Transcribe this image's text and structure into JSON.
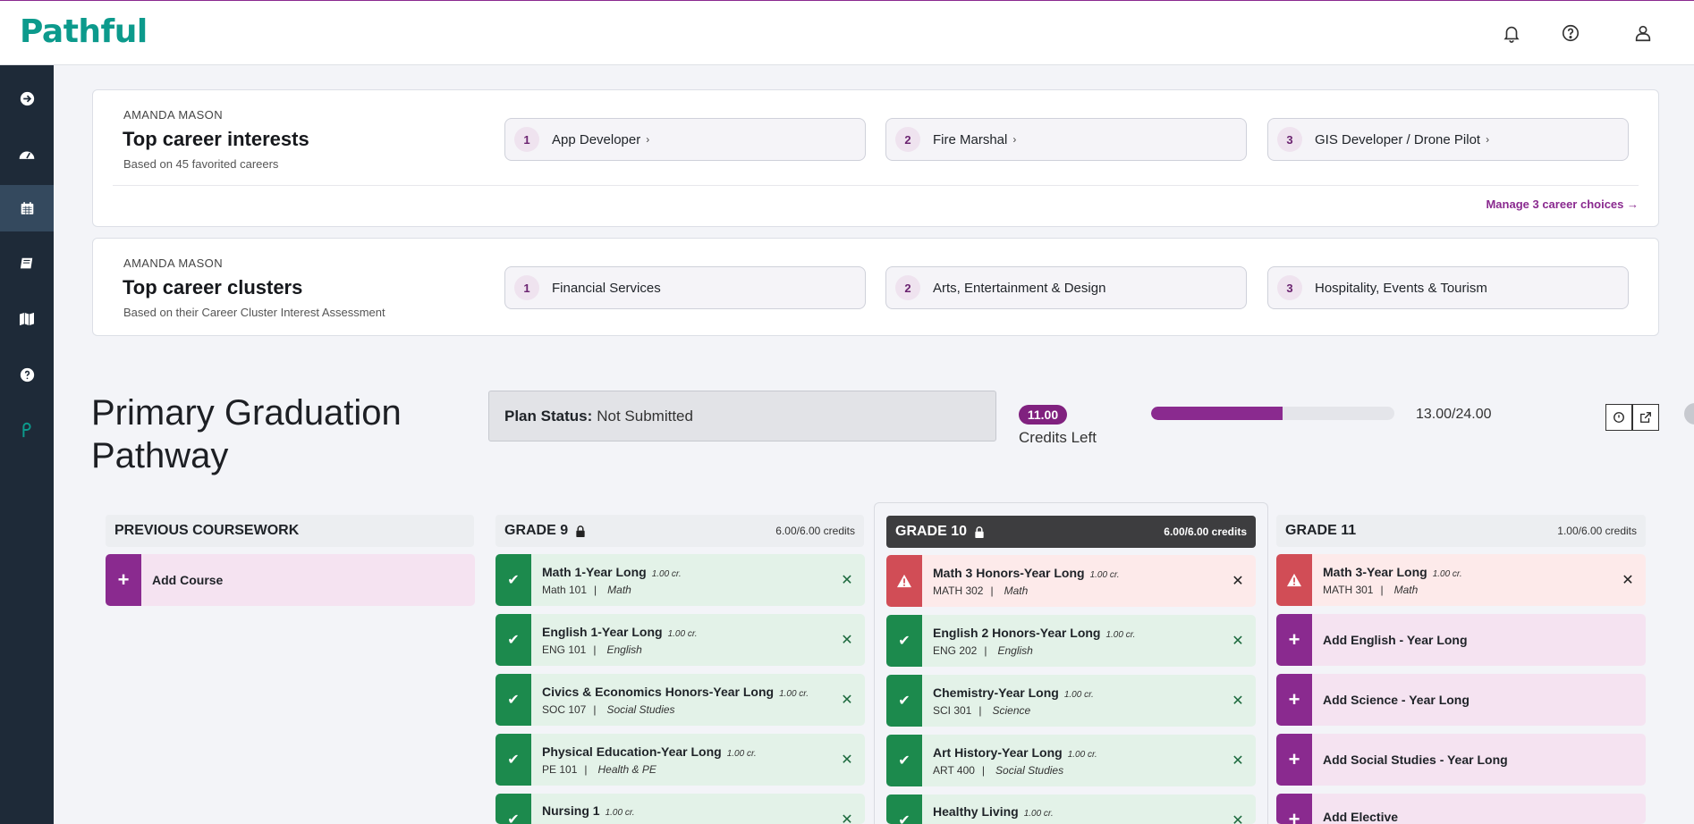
{
  "app": {
    "logo_text": "Pathful",
    "brand_color": "#8a2a8f",
    "logo_color": "#0c9a8c"
  },
  "header": {
    "icons": [
      "bell-icon",
      "help-icon",
      "user-icon"
    ]
  },
  "sidebar": {
    "items": [
      "arrow-right-icon",
      "dashboard-icon",
      "calendar-icon",
      "book-icon",
      "map-icon",
      "help-icon",
      "pathful-icon"
    ],
    "active_index": 2
  },
  "interests": {
    "owner": "AMANDA MASON",
    "title": "Top career interests",
    "subtitle": "Based on 45 favorited careers",
    "items": [
      {
        "num": "1",
        "label": "App Developer"
      },
      {
        "num": "2",
        "label": "Fire Marshal"
      },
      {
        "num": "3",
        "label": "GIS Developer / Drone Pilot"
      }
    ],
    "manage_link": "Manage 3 career choices →"
  },
  "clusters": {
    "owner": "AMANDA MASON",
    "title": "Top career clusters",
    "subtitle": "Based on their Career Cluster Interest Assessment",
    "items": [
      {
        "num": "1",
        "label": "Financial Services"
      },
      {
        "num": "2",
        "label": "Arts, Entertainment & Design"
      },
      {
        "num": "3",
        "label": "Hospitality, Events & Tourism"
      }
    ]
  },
  "pathway": {
    "title": "Primary Graduation Pathway",
    "plan_status_label": "Plan Status:",
    "plan_status_value": "Not Submitted",
    "credits_left_value": "11.00",
    "credits_left_label": "Credits Left",
    "progress_fraction": 0.5417,
    "progress_text": "13.00/24.00"
  },
  "columns": {
    "previous": {
      "title": "PREVIOUS COURSEWORK",
      "add_label": "Add Course"
    },
    "grade9": {
      "title": "GRADE 9",
      "credits": "6.00/6.00 credits",
      "courses": [
        {
          "name": "Math 1-Year Long",
          "cr": "1.00 cr.",
          "code": "Math 101",
          "subject": "Math"
        },
        {
          "name": "English 1-Year Long",
          "cr": "1.00 cr.",
          "code": "ENG 101",
          "subject": "English"
        },
        {
          "name": "Civics & Economics Honors-Year Long",
          "cr": "1.00 cr.",
          "code": "SOC 107",
          "subject": "Social Studies"
        },
        {
          "name": "Physical Education-Year Long",
          "cr": "1.00 cr.",
          "code": "PE 101",
          "subject": "Health & PE"
        },
        {
          "name": "Nursing 1",
          "cr": "1.00 cr.",
          "code": "",
          "subject": ""
        }
      ]
    },
    "grade10": {
      "title": "GRADE 10",
      "credits": "6.00/6.00 credits",
      "courses": [
        {
          "name": "Math 3 Honors-Year Long",
          "cr": "1.00 cr.",
          "code": "MATH 302",
          "subject": "Math",
          "status": "warn"
        },
        {
          "name": "English 2 Honors-Year Long",
          "cr": "1.00 cr.",
          "code": "ENG 202",
          "subject": "English",
          "status": "ok"
        },
        {
          "name": "Chemistry-Year Long",
          "cr": "1.00 cr.",
          "code": "SCI 301",
          "subject": "Science",
          "status": "ok"
        },
        {
          "name": "Art History-Year Long",
          "cr": "1.00 cr.",
          "code": "ART 400",
          "subject": "Social Studies",
          "status": "ok"
        },
        {
          "name": "Healthy Living",
          "cr": "1.00 cr.",
          "code": "",
          "subject": "",
          "status": "ok"
        }
      ]
    },
    "grade11": {
      "title": "GRADE 11",
      "credits": "1.00/6.00 credits",
      "course": {
        "name": "Math 3-Year Long",
        "cr": "1.00 cr.",
        "code": "MATH 301",
        "subject": "Math"
      },
      "adds": [
        "Add English - Year Long",
        "Add Science - Year Long",
        "Add Social Studies - Year Long",
        "Add Elective"
      ]
    }
  }
}
